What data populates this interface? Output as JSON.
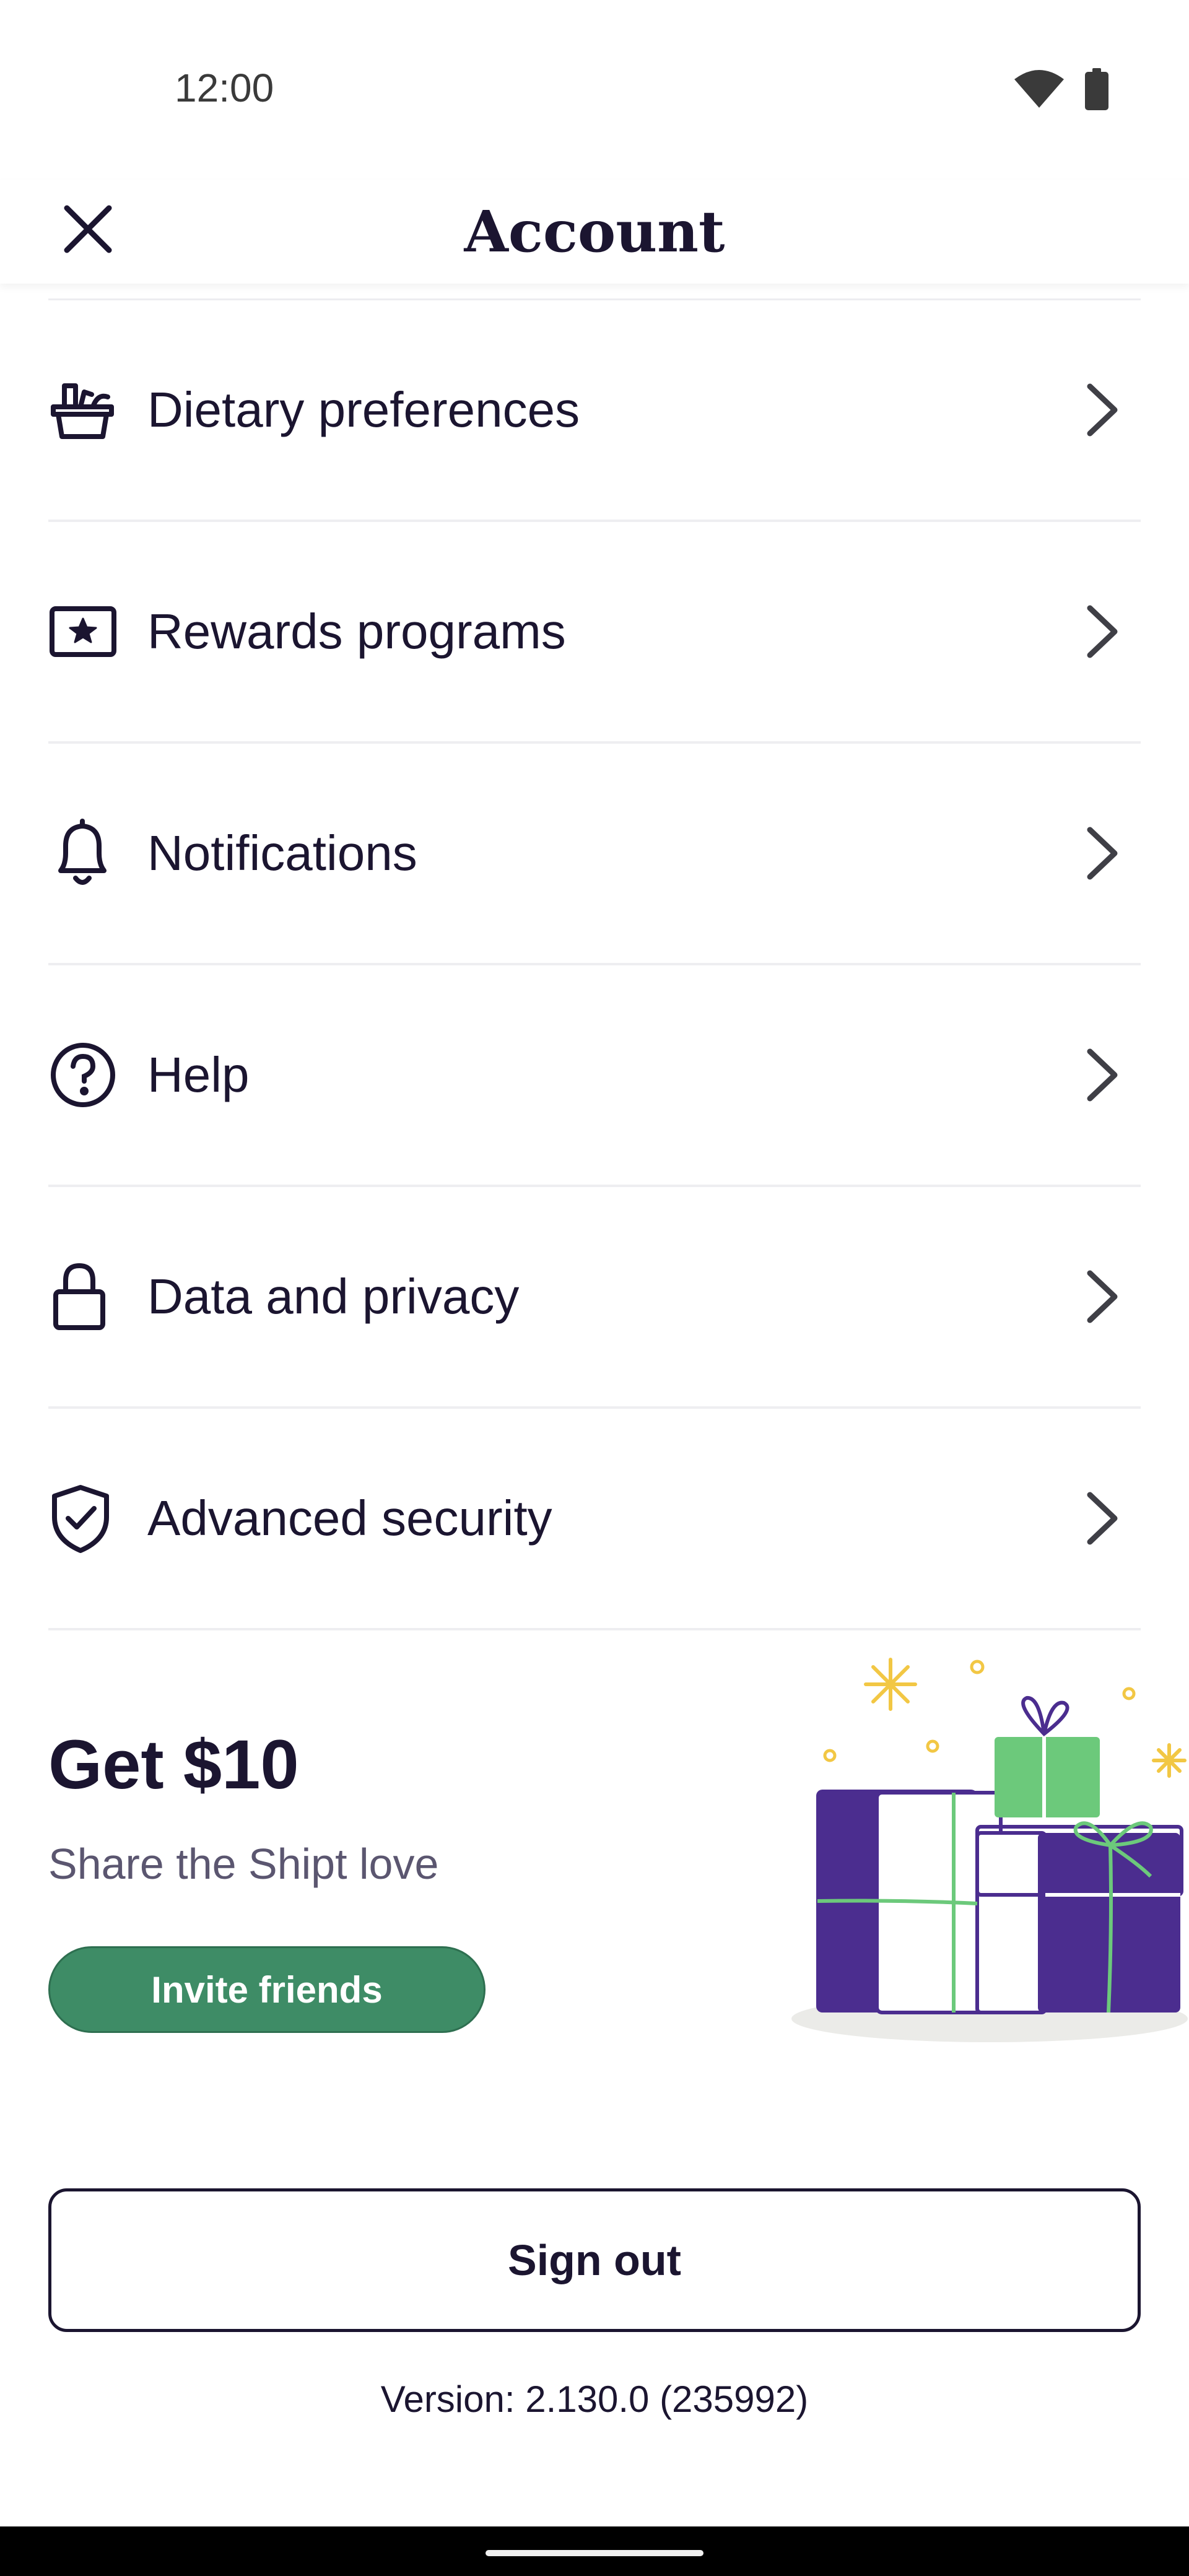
{
  "status_bar": {
    "time": "12:00",
    "icons": [
      "wifi-icon",
      "battery-icon"
    ]
  },
  "header": {
    "title": "Account",
    "close_icon": "close-icon"
  },
  "menu": {
    "items": [
      {
        "label": "Dietary preferences",
        "icon": "basket-icon"
      },
      {
        "label": "Rewards programs",
        "icon": "rewards-card-icon"
      },
      {
        "label": "Notifications",
        "icon": "bell-icon"
      },
      {
        "label": "Help",
        "icon": "help-icon"
      },
      {
        "label": "Data and privacy",
        "icon": "lock-icon"
      },
      {
        "label": "Advanced security",
        "icon": "shield-check-icon"
      }
    ]
  },
  "promo": {
    "title": "Get $10",
    "subtitle": "Share the Shipt love",
    "button_label": "Invite friends",
    "illustration": "gift-boxes-illustration"
  },
  "signout": {
    "label": "Sign out"
  },
  "version": "Version: 2.130.0 (235992)",
  "colors": {
    "text": "#1b1530",
    "invite_button": "#3e8c66",
    "gift_purple": "#4b2d8f",
    "gift_green": "#6cc97b",
    "sparkle": "#f2c744"
  }
}
